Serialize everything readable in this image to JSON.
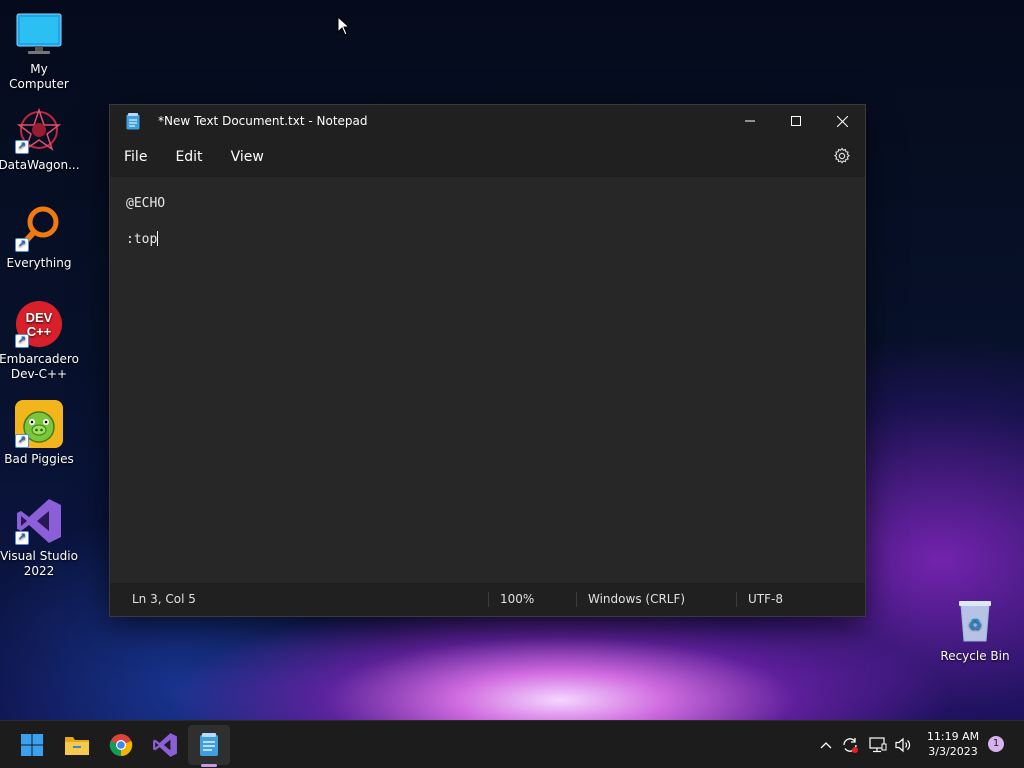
{
  "desktop": {
    "icons": [
      {
        "label": "My Computer",
        "icon": "monitor-icon"
      },
      {
        "label": "DataWagon...",
        "icon": "datawagon-icon"
      },
      {
        "label": "Everything",
        "icon": "magnifier-icon"
      },
      {
        "label": "Embarcadero Dev-C++",
        "icon": "devcpp-icon",
        "badge": "DEV C++"
      },
      {
        "label": "Bad Piggies",
        "icon": "bad-piggies-icon"
      },
      {
        "label": "Visual Studio 2022",
        "icon": "visual-studio-icon"
      },
      {
        "label": "Recycle Bin",
        "icon": "recycle-bin-icon"
      }
    ]
  },
  "notepad": {
    "title": "*New Text Document.txt - Notepad",
    "menu": [
      "File",
      "Edit",
      "View"
    ],
    "content": {
      "line1": "@ECHO",
      "line2": ":top"
    },
    "status": {
      "position": "Ln 3, Col 5",
      "zoom": "100%",
      "line_ending": "Windows (CRLF)",
      "encoding": "UTF-8"
    }
  },
  "taskbar": {
    "apps": [
      "start-icon",
      "file-explorer-icon",
      "chrome-icon",
      "visual-studio-icon",
      "notepad-icon"
    ],
    "active_app": "notepad-icon",
    "clock": {
      "time": "11:19 AM",
      "date": "3/3/2023"
    },
    "notification_count": "1"
  },
  "colors": {
    "accent": "#c79ce4",
    "window_bg": "#272727",
    "chrome_bg": "#202020"
  }
}
